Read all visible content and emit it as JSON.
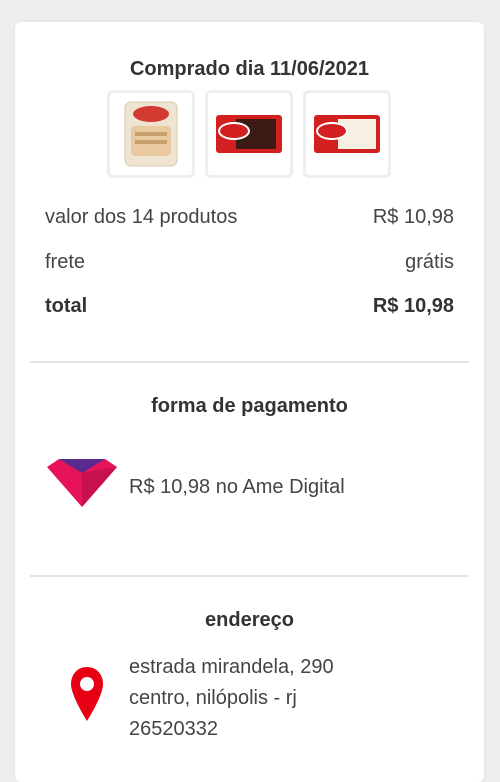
{
  "order": {
    "title": "Comprado dia 11/06/2021",
    "products": [
      {
        "name": "pão-de-forma-icon"
      },
      {
        "name": "kitkat-dark-icon"
      },
      {
        "name": "kitkat-white-icon"
      }
    ]
  },
  "summary": {
    "products_label": "valor dos 14 produtos",
    "products_value": "R$ 10,98",
    "shipping_label": "frete",
    "shipping_value": "grátis",
    "total_label": "total",
    "total_value": "R$ 10,98"
  },
  "payment": {
    "title": "forma de pagamento",
    "text": "R$ 10,98 no Ame Digital",
    "icon": "ame-digital-icon"
  },
  "address": {
    "title": "endereço",
    "line1": "estrada mirandela, 290",
    "line2": "centro, nilópolis - rj",
    "line3": "26520332",
    "icon": "location-pin-icon"
  },
  "colors": {
    "accent": "#e60014",
    "ame_pink": "#e6125a",
    "ame_dark": "#9a1b4f"
  }
}
